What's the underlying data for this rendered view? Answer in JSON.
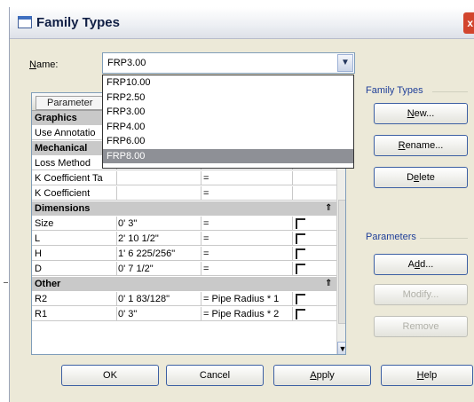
{
  "window": {
    "title": "Family Types",
    "close_glyph": "x"
  },
  "name_field": {
    "label": "Name:",
    "value": "FRP3.00",
    "dropdown_icon": "chevron-down-icon"
  },
  "dropdown": {
    "options": [
      "FRP10.00",
      "FRP2.50",
      "FRP3.00",
      "FRP4.00",
      "FRP6.00",
      "FRP8.00"
    ],
    "highlighted": "FRP8.00"
  },
  "grid": {
    "header": {
      "parameter": "Parameter"
    },
    "groups": [
      {
        "name": "Graphics",
        "rows": [
          {
            "param": "Use Annotatio",
            "value": "",
            "formula": "",
            "lock": false
          }
        ]
      },
      {
        "name": "Mechanical",
        "rows": [
          {
            "param": "Loss Method",
            "value": "",
            "formula": "=",
            "lock": false
          },
          {
            "param": "K Coefficient Ta",
            "value": "",
            "formula": "=",
            "lock": false
          },
          {
            "param": "K Coefficient",
            "value": "",
            "formula": "=",
            "lock": false
          }
        ]
      },
      {
        "name": "Dimensions",
        "rows": [
          {
            "param": "Size",
            "value": "0' 3\"",
            "formula": "=",
            "lock": true
          },
          {
            "param": "L",
            "value": "2' 10 1/2\"",
            "formula": "=",
            "lock": true
          },
          {
            "param": "H",
            "value": "1' 6 225/256\"",
            "formula": "=",
            "lock": true
          },
          {
            "param": "D",
            "value": "0' 7 1/2\"",
            "formula": "=",
            "lock": true
          }
        ]
      },
      {
        "name": "Other",
        "rows": [
          {
            "param": "R2",
            "value": "0' 1 83/128\"",
            "formula": "= Pipe Radius * 1",
            "lock": true
          },
          {
            "param": "R1",
            "value": "0' 3\"",
            "formula": "= Pipe Radius * 2",
            "lock": true
          }
        ]
      }
    ],
    "collapse_glyph": "⇑"
  },
  "family_types": {
    "label": "Family Types",
    "new_label": "New...",
    "rename_label": "Rename...",
    "delete_label": "Delete"
  },
  "parameters": {
    "label": "Parameters",
    "add_label": "Add...",
    "modify_label": "Modify...",
    "remove_label": "Remove"
  },
  "footer": {
    "ok_label": "OK",
    "cancel_label": "Cancel",
    "apply_label": "Apply",
    "help_label": "Help"
  }
}
